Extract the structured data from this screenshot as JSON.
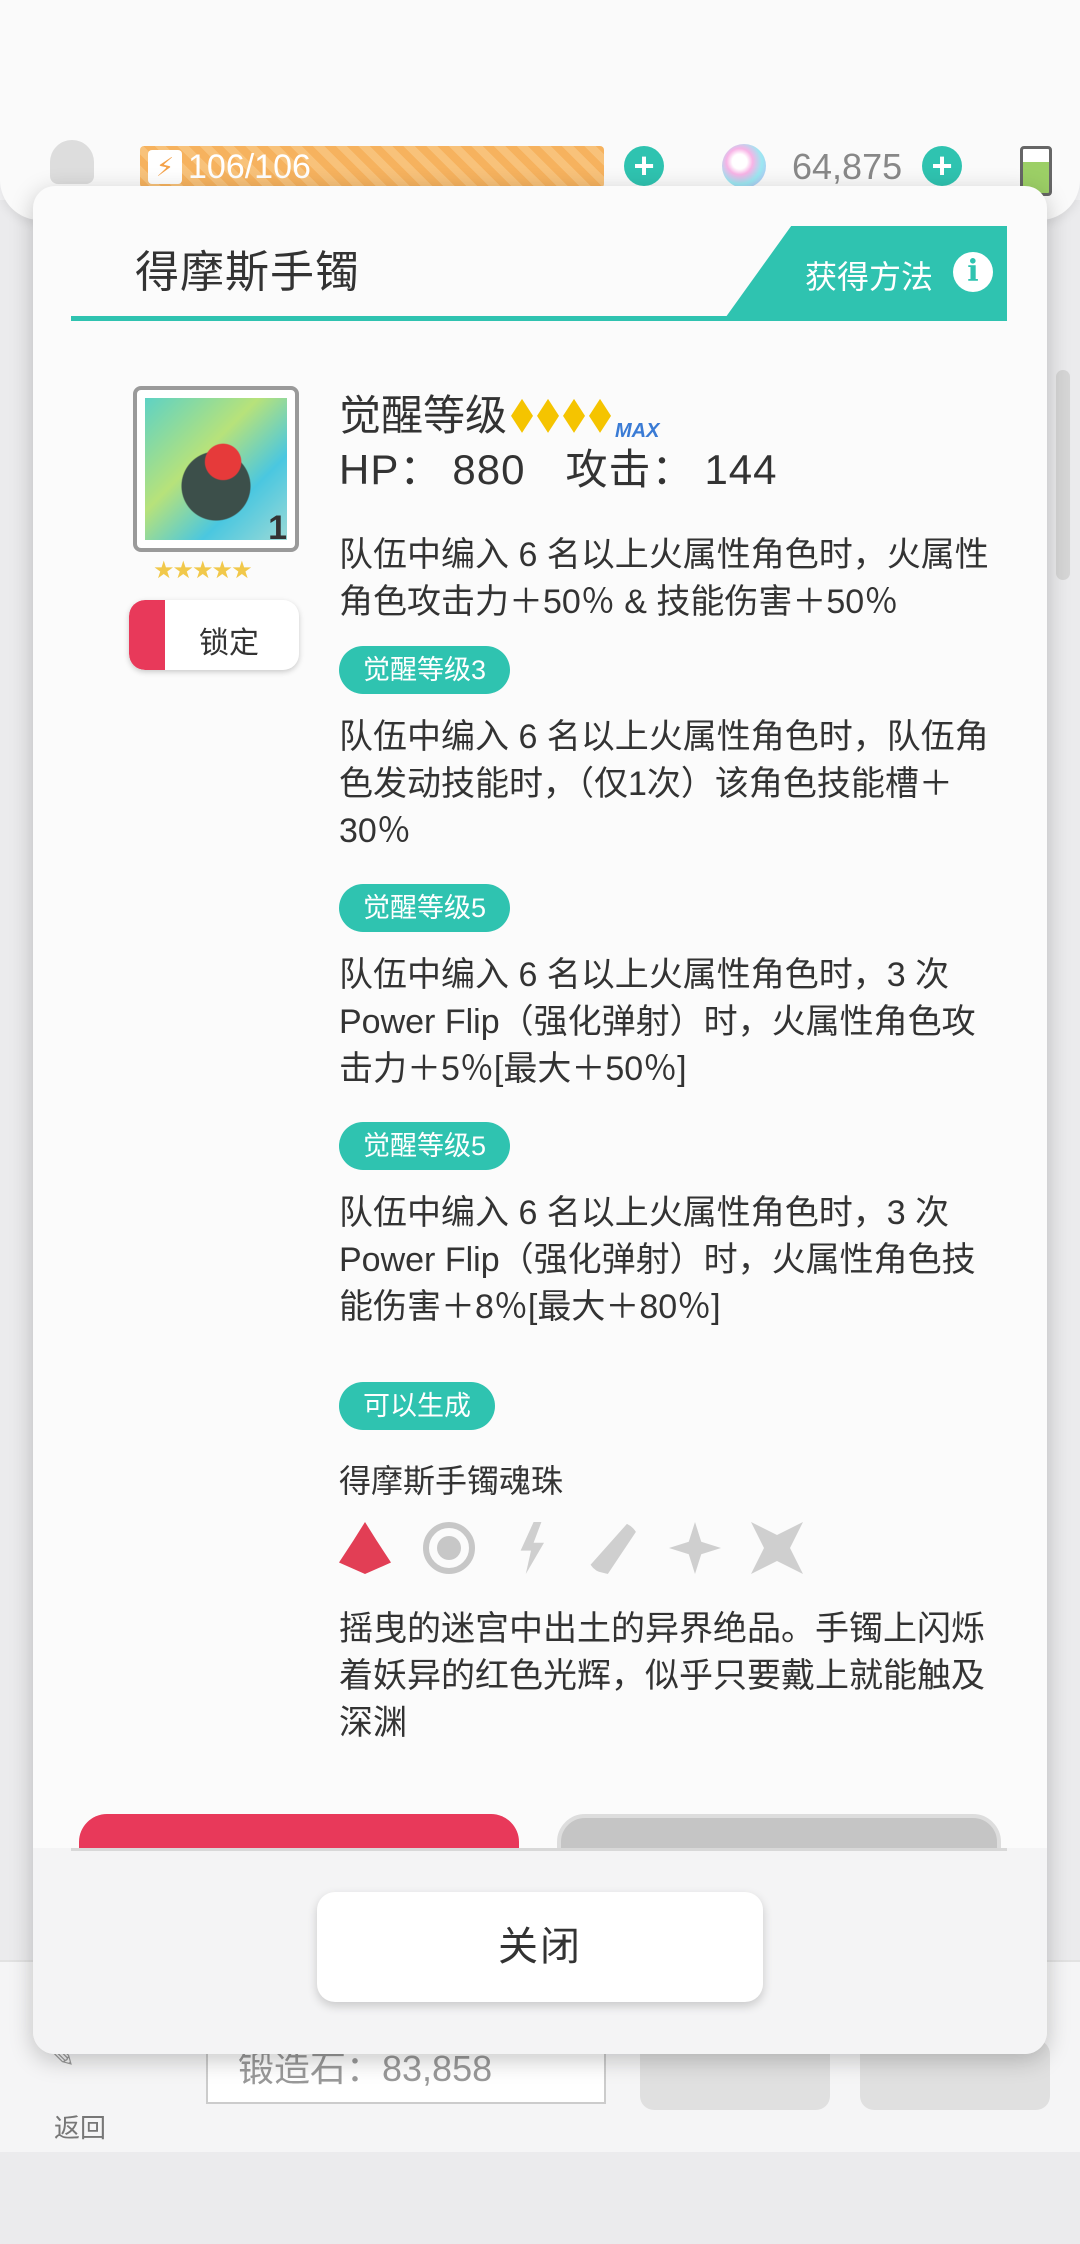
{
  "topbar": {
    "stamina_text": "106/106",
    "gem_count": "64,875"
  },
  "bottom_bar": {
    "back_label": "返回",
    "field_text": "锻造石：83,858"
  },
  "modal": {
    "title": "得摩斯手镯",
    "how_to_get_label": "获得方法",
    "item": {
      "count": "1",
      "stars": "★★★★★",
      "lock_label": "锁定"
    },
    "awaken_label": "觉醒等级",
    "awaken_max_label": "MAX",
    "stats": {
      "hp_label": "HP：",
      "hp_value": "880",
      "atk_label": "攻击：",
      "atk_value": "144"
    },
    "effects": [
      {
        "text": "队伍中编入 6 名以上火属性角色时，火属性角色攻击力＋50％ & 技能伤害＋50％"
      },
      {
        "tag": "觉醒等级3",
        "text": "队伍中编入 6 名以上火属性角色时，队伍角色发动技能时，（仅1次）该角色技能槽＋30％"
      },
      {
        "tag": "觉醒等级5",
        "text": "队伍中编入 6 名以上火属性角色时，3 次Power Flip（强化弹射）时，火属性角色攻击力＋5％[最大＋50％]"
      },
      {
        "tag": "觉醒等级5",
        "text": "队伍中编入 6 名以上火属性角色时，3 次Power Flip（强化弹射）时，火属性角色技能伤害＋8％[最大＋80％]"
      }
    ],
    "craftable_tag": "可以生成",
    "soul_name": "得摩斯手镯魂珠",
    "elements": [
      "fire-icon",
      "water-icon",
      "thunder-icon",
      "wind-icon",
      "light-icon",
      "dark-icon"
    ],
    "active_element": "fire",
    "flavor_text": "摇曳的迷宫中出土的异界绝品。手镯上闪烁着妖异的红色光辉，似乎只要戴上就能触及深渊",
    "close_label": "关闭"
  },
  "colors": {
    "accent": "#2fc3b0",
    "fire": "#e23e55",
    "inactive_element": "#cfcfcf"
  }
}
